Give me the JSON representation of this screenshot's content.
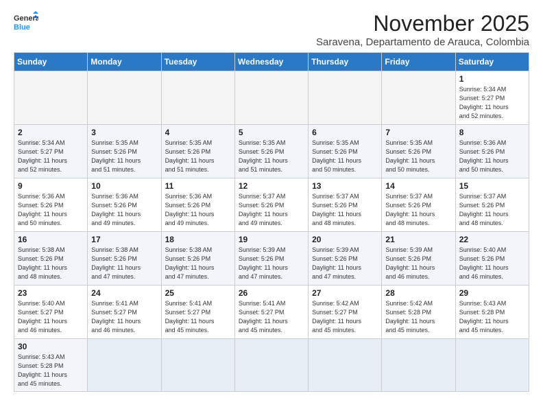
{
  "header": {
    "logo_line1": "General",
    "logo_line2": "Blue",
    "month": "November 2025",
    "location": "Saravena, Departamento de Arauca, Colombia"
  },
  "weekdays": [
    "Sunday",
    "Monday",
    "Tuesday",
    "Wednesday",
    "Thursday",
    "Friday",
    "Saturday"
  ],
  "weeks": [
    [
      {
        "day": "",
        "info": ""
      },
      {
        "day": "",
        "info": ""
      },
      {
        "day": "",
        "info": ""
      },
      {
        "day": "",
        "info": ""
      },
      {
        "day": "",
        "info": ""
      },
      {
        "day": "",
        "info": ""
      },
      {
        "day": "1",
        "info": "Sunrise: 5:34 AM\nSunset: 5:27 PM\nDaylight: 11 hours\nand 52 minutes."
      }
    ],
    [
      {
        "day": "2",
        "info": "Sunrise: 5:34 AM\nSunset: 5:27 PM\nDaylight: 11 hours\nand 52 minutes."
      },
      {
        "day": "3",
        "info": "Sunrise: 5:35 AM\nSunset: 5:26 PM\nDaylight: 11 hours\nand 51 minutes."
      },
      {
        "day": "4",
        "info": "Sunrise: 5:35 AM\nSunset: 5:26 PM\nDaylight: 11 hours\nand 51 minutes."
      },
      {
        "day": "5",
        "info": "Sunrise: 5:35 AM\nSunset: 5:26 PM\nDaylight: 11 hours\nand 51 minutes."
      },
      {
        "day": "6",
        "info": "Sunrise: 5:35 AM\nSunset: 5:26 PM\nDaylight: 11 hours\nand 50 minutes."
      },
      {
        "day": "7",
        "info": "Sunrise: 5:35 AM\nSunset: 5:26 PM\nDaylight: 11 hours\nand 50 minutes."
      },
      {
        "day": "8",
        "info": "Sunrise: 5:36 AM\nSunset: 5:26 PM\nDaylight: 11 hours\nand 50 minutes."
      }
    ],
    [
      {
        "day": "9",
        "info": "Sunrise: 5:36 AM\nSunset: 5:26 PM\nDaylight: 11 hours\nand 50 minutes."
      },
      {
        "day": "10",
        "info": "Sunrise: 5:36 AM\nSunset: 5:26 PM\nDaylight: 11 hours\nand 49 minutes."
      },
      {
        "day": "11",
        "info": "Sunrise: 5:36 AM\nSunset: 5:26 PM\nDaylight: 11 hours\nand 49 minutes."
      },
      {
        "day": "12",
        "info": "Sunrise: 5:37 AM\nSunset: 5:26 PM\nDaylight: 11 hours\nand 49 minutes."
      },
      {
        "day": "13",
        "info": "Sunrise: 5:37 AM\nSunset: 5:26 PM\nDaylight: 11 hours\nand 48 minutes."
      },
      {
        "day": "14",
        "info": "Sunrise: 5:37 AM\nSunset: 5:26 PM\nDaylight: 11 hours\nand 48 minutes."
      },
      {
        "day": "15",
        "info": "Sunrise: 5:37 AM\nSunset: 5:26 PM\nDaylight: 11 hours\nand 48 minutes."
      }
    ],
    [
      {
        "day": "16",
        "info": "Sunrise: 5:38 AM\nSunset: 5:26 PM\nDaylight: 11 hours\nand 48 minutes."
      },
      {
        "day": "17",
        "info": "Sunrise: 5:38 AM\nSunset: 5:26 PM\nDaylight: 11 hours\nand 47 minutes."
      },
      {
        "day": "18",
        "info": "Sunrise: 5:38 AM\nSunset: 5:26 PM\nDaylight: 11 hours\nand 47 minutes."
      },
      {
        "day": "19",
        "info": "Sunrise: 5:39 AM\nSunset: 5:26 PM\nDaylight: 11 hours\nand 47 minutes."
      },
      {
        "day": "20",
        "info": "Sunrise: 5:39 AM\nSunset: 5:26 PM\nDaylight: 11 hours\nand 47 minutes."
      },
      {
        "day": "21",
        "info": "Sunrise: 5:39 AM\nSunset: 5:26 PM\nDaylight: 11 hours\nand 46 minutes."
      },
      {
        "day": "22",
        "info": "Sunrise: 5:40 AM\nSunset: 5:26 PM\nDaylight: 11 hours\nand 46 minutes."
      }
    ],
    [
      {
        "day": "23",
        "info": "Sunrise: 5:40 AM\nSunset: 5:27 PM\nDaylight: 11 hours\nand 46 minutes."
      },
      {
        "day": "24",
        "info": "Sunrise: 5:41 AM\nSunset: 5:27 PM\nDaylight: 11 hours\nand 46 minutes."
      },
      {
        "day": "25",
        "info": "Sunrise: 5:41 AM\nSunset: 5:27 PM\nDaylight: 11 hours\nand 45 minutes."
      },
      {
        "day": "26",
        "info": "Sunrise: 5:41 AM\nSunset: 5:27 PM\nDaylight: 11 hours\nand 45 minutes."
      },
      {
        "day": "27",
        "info": "Sunrise: 5:42 AM\nSunset: 5:27 PM\nDaylight: 11 hours\nand 45 minutes."
      },
      {
        "day": "28",
        "info": "Sunrise: 5:42 AM\nSunset: 5:28 PM\nDaylight: 11 hours\nand 45 minutes."
      },
      {
        "day": "29",
        "info": "Sunrise: 5:43 AM\nSunset: 5:28 PM\nDaylight: 11 hours\nand 45 minutes."
      }
    ],
    [
      {
        "day": "30",
        "info": "Sunrise: 5:43 AM\nSunset: 5:28 PM\nDaylight: 11 hours\nand 45 minutes."
      },
      {
        "day": "",
        "info": ""
      },
      {
        "day": "",
        "info": ""
      },
      {
        "day": "",
        "info": ""
      },
      {
        "day": "",
        "info": ""
      },
      {
        "day": "",
        "info": ""
      },
      {
        "day": "",
        "info": ""
      }
    ]
  ],
  "row_classes": [
    "row-white",
    "row-blue",
    "row-white",
    "row-blue",
    "row-white",
    "row-blue"
  ]
}
